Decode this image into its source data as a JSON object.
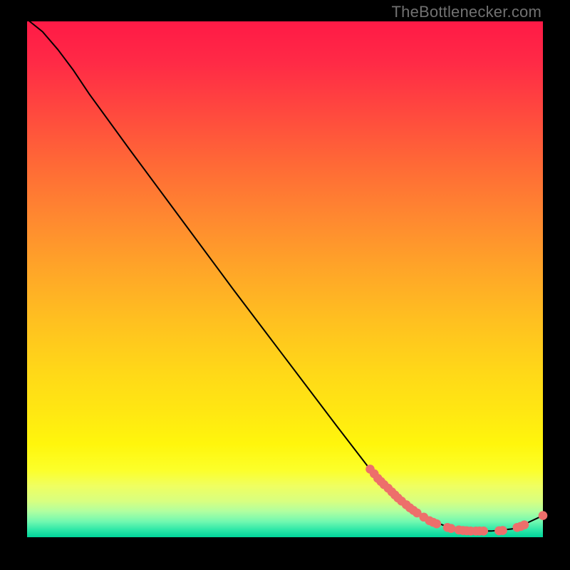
{
  "watermark": "TheBottlenecker.com",
  "colors": {
    "curve": "#000000",
    "dot_fill": "#ed6f6b",
    "dot_stroke": "#b84e4e"
  },
  "chart_data": {
    "type": "line",
    "title": "",
    "xlabel": "",
    "ylabel": "",
    "xlim": [
      0,
      100
    ],
    "ylim": [
      0,
      100
    ],
    "grid": false,
    "curve": [
      {
        "x": 0.5,
        "y": 100
      },
      {
        "x": 3,
        "y": 98
      },
      {
        "x": 6,
        "y": 94.5
      },
      {
        "x": 9,
        "y": 90.5
      },
      {
        "x": 12,
        "y": 86
      },
      {
        "x": 20,
        "y": 75
      },
      {
        "x": 30,
        "y": 61.5
      },
      {
        "x": 40,
        "y": 48
      },
      {
        "x": 50,
        "y": 34.8
      },
      {
        "x": 60,
        "y": 21.6
      },
      {
        "x": 66,
        "y": 13.8
      },
      {
        "x": 70,
        "y": 9.5
      },
      {
        "x": 74,
        "y": 6
      },
      {
        "x": 78,
        "y": 3.4
      },
      {
        "x": 82,
        "y": 1.8
      },
      {
        "x": 86,
        "y": 1.2
      },
      {
        "x": 90,
        "y": 1.2
      },
      {
        "x": 94,
        "y": 1.6
      },
      {
        "x": 97,
        "y": 2.8
      },
      {
        "x": 100,
        "y": 4.2
      }
    ],
    "points": [
      {
        "x": 66.5,
        "y": 13.2
      },
      {
        "x": 67.3,
        "y": 12.3
      },
      {
        "x": 68.0,
        "y": 11.4
      },
      {
        "x": 68.6,
        "y": 10.8
      },
      {
        "x": 69.2,
        "y": 10.2
      },
      {
        "x": 70.0,
        "y": 9.5
      },
      {
        "x": 70.7,
        "y": 8.8
      },
      {
        "x": 71.3,
        "y": 8.2
      },
      {
        "x": 71.9,
        "y": 7.6
      },
      {
        "x": 72.6,
        "y": 7.0
      },
      {
        "x": 73.5,
        "y": 6.3
      },
      {
        "x": 74.2,
        "y": 5.7
      },
      {
        "x": 74.9,
        "y": 5.2
      },
      {
        "x": 75.6,
        "y": 4.7
      },
      {
        "x": 76.9,
        "y": 3.9
      },
      {
        "x": 78.0,
        "y": 3.2
      },
      {
        "x": 78.7,
        "y": 2.9
      },
      {
        "x": 79.4,
        "y": 2.6
      },
      {
        "x": 81.5,
        "y": 1.9
      },
      {
        "x": 82.2,
        "y": 1.7
      },
      {
        "x": 83.7,
        "y": 1.4
      },
      {
        "x": 84.5,
        "y": 1.3
      },
      {
        "x": 85.2,
        "y": 1.25
      },
      {
        "x": 86.0,
        "y": 1.2
      },
      {
        "x": 87.0,
        "y": 1.2
      },
      {
        "x": 87.7,
        "y": 1.2
      },
      {
        "x": 88.5,
        "y": 1.2
      },
      {
        "x": 91.5,
        "y": 1.25
      },
      {
        "x": 92.2,
        "y": 1.3
      },
      {
        "x": 95.0,
        "y": 1.9
      },
      {
        "x": 95.7,
        "y": 2.1
      },
      {
        "x": 96.4,
        "y": 2.4
      },
      {
        "x": 100,
        "y": 4.2
      }
    ],
    "point_radius": 6.3
  }
}
